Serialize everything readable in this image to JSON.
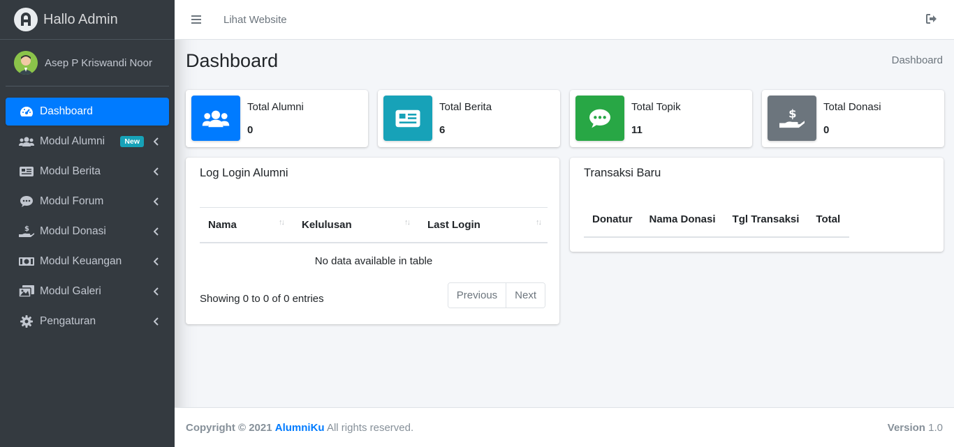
{
  "brand": {
    "title": "Hallo Admin"
  },
  "user": {
    "name": "Asep P Kriswandi Noor"
  },
  "sidebar": {
    "items": [
      {
        "label": "Dashboard",
        "icon": "tachometer-icon",
        "active": true
      },
      {
        "label": "Modul Alumni",
        "icon": "users-icon",
        "badge": "New"
      },
      {
        "label": "Modul Berita",
        "icon": "newspaper-icon"
      },
      {
        "label": "Modul Forum",
        "icon": "comment-icon"
      },
      {
        "label": "Modul Donasi",
        "icon": "hand-holding-usd-icon"
      },
      {
        "label": "Modul Keuangan",
        "icon": "money-bill-icon"
      },
      {
        "label": "Modul Galeri",
        "icon": "images-icon"
      },
      {
        "label": "Pengaturan",
        "icon": "cog-icon"
      }
    ]
  },
  "topbar": {
    "link": "Lihat Website"
  },
  "page": {
    "title": "Dashboard",
    "breadcrumb": "Dashboard"
  },
  "stats": [
    {
      "label": "Total Alumni",
      "value": "0",
      "color": "#007bff",
      "icon": "users-icon"
    },
    {
      "label": "Total Berita",
      "value": "6",
      "color": "#17a2b8",
      "icon": "newspaper-icon"
    },
    {
      "label": "Total Topik",
      "value": "11",
      "color": "#28a745",
      "icon": "comment-dots-icon"
    },
    {
      "label": "Total Donasi",
      "value": "0",
      "color": "#6c757d",
      "icon": "hand-holding-usd-icon"
    }
  ],
  "log_login": {
    "title": "Log Login Alumni",
    "columns": [
      "Nama",
      "Kelulusan",
      "Last Login"
    ],
    "empty": "No data available in table",
    "info": "Showing 0 to 0 of 0 entries",
    "prev": "Previous",
    "next": "Next"
  },
  "transaksi": {
    "title": "Transaksi Baru",
    "columns": [
      "Donatur",
      "Nama Donasi",
      "Tgl Transaksi",
      "Total"
    ]
  },
  "footer": {
    "copyright": "Copyright © 2021",
    "brand": "AlumniKu",
    "rights": "All rights reserved.",
    "version_label": "Version",
    "version": "1.0"
  }
}
